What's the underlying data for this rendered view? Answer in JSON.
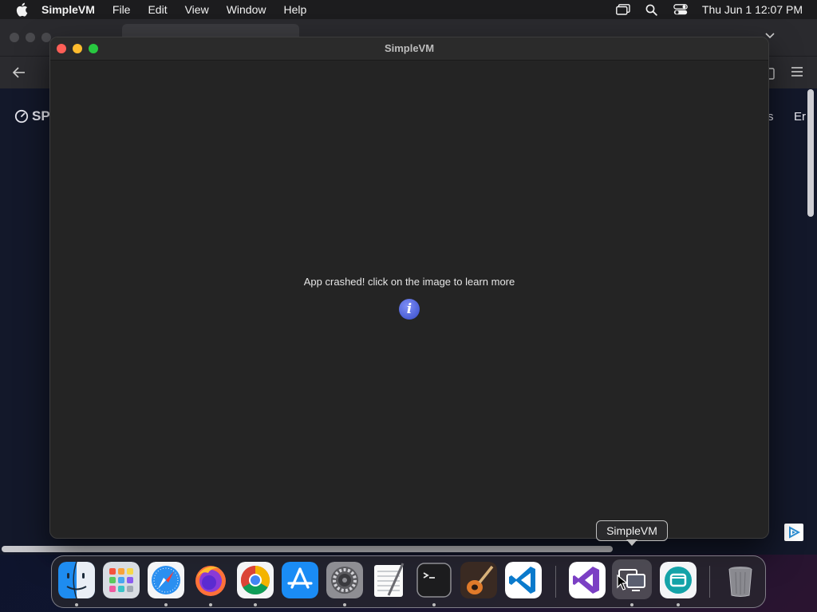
{
  "menubar": {
    "app_name": "SimpleVM",
    "items": [
      "File",
      "Edit",
      "View",
      "Window",
      "Help"
    ],
    "clock": "Thu Jun 1  12:07 PM"
  },
  "browser": {
    "site_logo_text": "SP",
    "site_nav_1": "s",
    "site_nav_2": "Er"
  },
  "window": {
    "title": "SimpleVM",
    "message": "App crashed! click on the image to learn more",
    "info_icon": "i"
  },
  "dock": {
    "tooltip": "SimpleVM",
    "apps": [
      {
        "name": "finder",
        "label": "Finder"
      },
      {
        "name": "launchpad",
        "label": "Launchpad"
      },
      {
        "name": "safari",
        "label": "Safari"
      },
      {
        "name": "firefox",
        "label": "Firefox"
      },
      {
        "name": "chrome",
        "label": "Google Chrome"
      },
      {
        "name": "app-store",
        "label": "App Store"
      },
      {
        "name": "system-settings",
        "label": "System Settings"
      },
      {
        "name": "textedit",
        "label": "TextEdit"
      },
      {
        "name": "terminal",
        "label": "Terminal"
      },
      {
        "name": "garageband",
        "label": "GarageBand"
      },
      {
        "name": "vscode",
        "label": "Visual Studio Code"
      },
      {
        "name": "visual-studio",
        "label": "Visual Studio"
      },
      {
        "name": "simplevm",
        "label": "SimpleVM"
      },
      {
        "name": "teal-app",
        "label": "App"
      },
      {
        "name": "trash",
        "label": "Trash"
      }
    ]
  },
  "colors": {
    "menubar_bg": "#1c1c1e",
    "window_bg": "#242424",
    "info_blue": "#4b5fd6",
    "close_red": "#ff5f57",
    "minimize_yellow": "#febc2e",
    "zoom_green": "#28c840"
  }
}
